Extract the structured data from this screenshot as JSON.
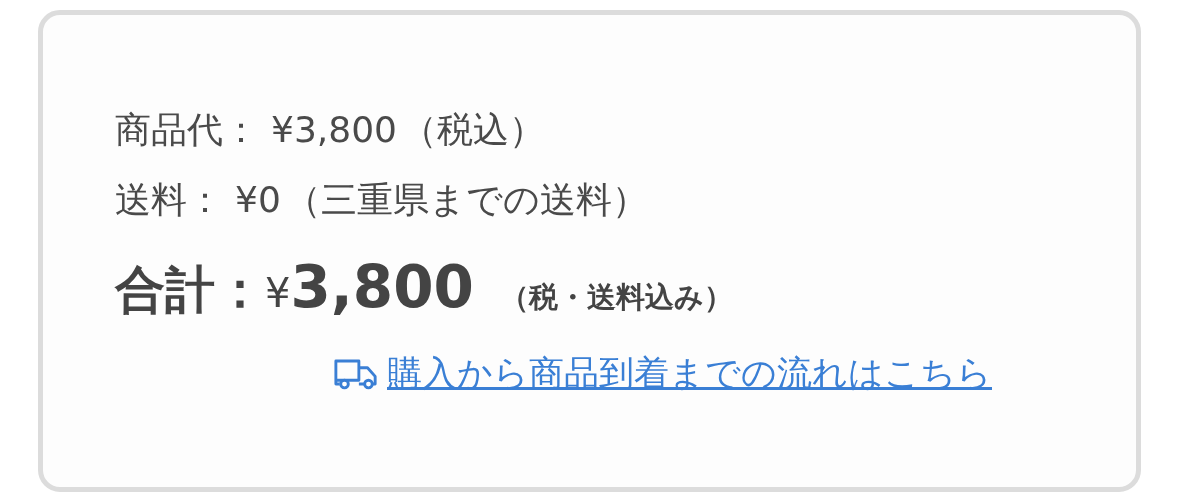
{
  "lines": [
    {
      "label": "商品代：",
      "value": "¥3,800",
      "note": "（税込）"
    },
    {
      "label": "送料：",
      "value": "¥0",
      "note": "（三重県までの送料）"
    }
  ],
  "total": {
    "label": "合計：",
    "currency": "¥",
    "amount": "3,800",
    "note": "（税・送料込み）"
  },
  "link": {
    "text": "購入から商品到着までの流れはこちら"
  }
}
